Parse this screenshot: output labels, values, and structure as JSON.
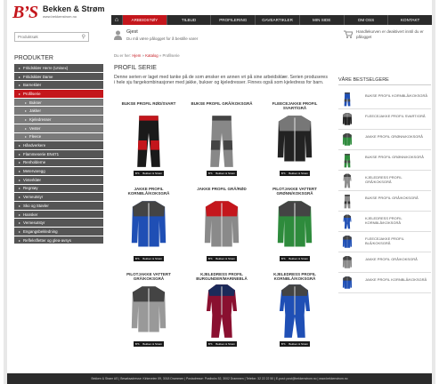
{
  "brand": {
    "mark": "B’S",
    "name": "Bekken & Strøm",
    "url": "www.bekkenstrom.no"
  },
  "topnav": {
    "home_icon": "home-icon",
    "items": [
      "ARBEIDSTØY",
      "TILBUD",
      "PROFILERING",
      "GAVEARTIKLER",
      "MIN SIDE",
      "OM OSS",
      "KONTAKT"
    ]
  },
  "search": {
    "placeholder": "Produktsøk",
    "icon": "search-icon"
  },
  "user": {
    "title": "Gjest",
    "subtitle": "Du må være pålogget for å bestille varer"
  },
  "cart": {
    "text": "Handlekurven er deaktivert inntil du er pålogget"
  },
  "sidebar": {
    "title": "PRODUKTER",
    "items": [
      {
        "label": "Fritidsklær Herre (Unisex)",
        "type": "main"
      },
      {
        "label": "Fritidsklær Dame",
        "type": "main"
      },
      {
        "label": "Barneklær",
        "type": "main"
      },
      {
        "label": "Profilserie",
        "type": "active"
      },
      {
        "label": "Bukser",
        "type": "sub"
      },
      {
        "label": "Jakker",
        "type": "sub"
      },
      {
        "label": "Kjeledresser",
        "type": "sub"
      },
      {
        "label": "Vester",
        "type": "sub"
      },
      {
        "label": "Fleece",
        "type": "sub"
      },
      {
        "label": "Håndverkere",
        "type": "main"
      },
      {
        "label": "Flammeserie EN471",
        "type": "main"
      },
      {
        "label": "Renholderne",
        "type": "main"
      },
      {
        "label": "Metervaregg",
        "type": "main"
      },
      {
        "label": "Vinterklær",
        "type": "main"
      },
      {
        "label": "Regntøy",
        "type": "main"
      },
      {
        "label": "Verneutstyr",
        "type": "main"
      },
      {
        "label": "Sko og Støvler",
        "type": "main"
      },
      {
        "label": "Hansker",
        "type": "main"
      },
      {
        "label": "Vernesutstyr",
        "type": "main"
      },
      {
        "label": "Engangsbekledning",
        "type": "main"
      },
      {
        "label": "Refleksfletter og glea-avsys",
        "type": "main"
      }
    ]
  },
  "breadcrumb": {
    "prefix": "Du er her:",
    "items": [
      "Hjem",
      "Katalog"
    ],
    "current": "Profilserie"
  },
  "page": {
    "title": "PROFIL SERIE",
    "description": "Denne serien er laget med tanke på de som ønsker en annen vri på sine arbeidsklær. Serien produseres i hele sju fargekombinasjoner med jakke, bukser og kjeledresser. Finnes også som kjeledress for barn."
  },
  "products": [
    {
      "name": "BUKSE PROFIL RØD/SVART",
      "kind": "pants",
      "c1": "#1a1a1a",
      "c2": "#c4161c"
    },
    {
      "name": "BUKSE PROFIL GRÅ/KOKSGRÅ",
      "kind": "pants",
      "c1": "#888888",
      "c2": "#444444"
    },
    {
      "name": "FLEECEJAKKE PROFIL SVART/GRÅ",
      "kind": "jacket",
      "c1": "#222222",
      "c2": "#777777"
    },
    {
      "name": "JAKKE PROFIL KORNBLÅ/KOKSGRÅ",
      "kind": "jacket",
      "c1": "#1f4fb5",
      "c2": "#444444"
    },
    {
      "name": "JAKKE PROFIL GRÅ/RØD",
      "kind": "jacket",
      "c1": "#8a8a8a",
      "c2": "#c4161c"
    },
    {
      "name": "PILOTJAKKE VATTERT GRØNN/KOKSGRÅ",
      "kind": "jacket",
      "c1": "#2e8b3c",
      "c2": "#444444"
    },
    {
      "name": "PILOTJAKKE VATTERT GRÅ/KOKSGRÅ",
      "kind": "jacket",
      "c1": "#999999",
      "c2": "#444444"
    },
    {
      "name": "KJELEDRESS PROFIL BURGUNDER/MARINEBLÅ",
      "kind": "coverall",
      "c1": "#8a1030",
      "c2": "#1b2a5a"
    },
    {
      "name": "KJELEDRESS PROFIL KORNBLÅ/KOKSGRÅ",
      "kind": "coverall",
      "c1": "#1f4fb5",
      "c2": "#444444"
    }
  ],
  "product_brand_label": "Bekken & Strøm",
  "bestsellers": {
    "title": "VÅRE BESTSELGERE",
    "items": [
      {
        "name": "BUKSE PROFIL KORNBLÅ/KOKSGRÅ",
        "kind": "pants",
        "c1": "#1f4fb5",
        "c2": "#444444"
      },
      {
        "name": "FLEECEJAKKE PROFIL SVART/GRÅ",
        "kind": "jacket",
        "c1": "#222222",
        "c2": "#777777"
      },
      {
        "name": "JAKKE PROFIL GRØNN/KOKSGRÅ",
        "kind": "jacket",
        "c1": "#2e8b3c",
        "c2": "#444444"
      },
      {
        "name": "BUKSE PROFIL GRØNN/KOKSGRÅ",
        "kind": "pants",
        "c1": "#2e8b3c",
        "c2": "#444444"
      },
      {
        "name": "KJELEDRESS PROFIL GRÅ/KOKSGRÅ",
        "kind": "coverall",
        "c1": "#8a8a8a",
        "c2": "#444444"
      },
      {
        "name": "BUKSE PROFIL GRÅ/KOKSGRÅ",
        "kind": "pants",
        "c1": "#888888",
        "c2": "#333333"
      },
      {
        "name": "KJELEDRESS PROFIL KORNBLÅ/KOKSGRÅ",
        "kind": "coverall",
        "c1": "#1f4fb5",
        "c2": "#444444"
      },
      {
        "name": "FLEECEJAKKE PROFIL BLÅ/KOKSGRÅ",
        "kind": "jacket",
        "c1": "#1f4fb5",
        "c2": "#444444"
      },
      {
        "name": "JAKKE PROFIL GRÅ/KOKSGRÅ",
        "kind": "jacket",
        "c1": "#8a8a8a",
        "c2": "#444444"
      },
      {
        "name": "JAKKE PROFIL KORNBLÅ/KOKSGRÅ",
        "kind": "jacket",
        "c1": "#1f4fb5",
        "c2": "#444444"
      }
    ]
  },
  "footer": "Bekken & Strøm AS | Besøksadresse: Kirkeveien 59, 3018 Drammen | Postadresse: Postboks 52, 3002 Drammen | Telefon: 32 22 22 50 | E-post: post@bekkenstrom.no | www.bekkenstrom.no",
  "colors": {
    "accent": "#c4161c",
    "nav": "#2b2b2b",
    "sidebar": "#555555"
  }
}
